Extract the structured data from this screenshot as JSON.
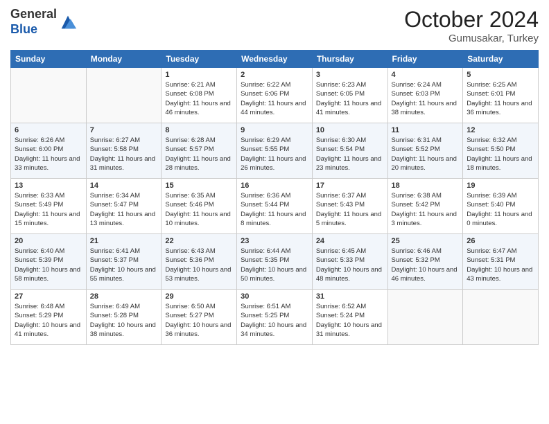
{
  "header": {
    "logo_general": "General",
    "logo_blue": "Blue",
    "month_title": "October 2024",
    "location": "Gumusakar, Turkey"
  },
  "days_of_week": [
    "Sunday",
    "Monday",
    "Tuesday",
    "Wednesday",
    "Thursday",
    "Friday",
    "Saturday"
  ],
  "weeks": [
    [
      {
        "day": "",
        "sunrise": "",
        "sunset": "",
        "daylight": ""
      },
      {
        "day": "",
        "sunrise": "",
        "sunset": "",
        "daylight": ""
      },
      {
        "day": "1",
        "sunrise": "Sunrise: 6:21 AM",
        "sunset": "Sunset: 6:08 PM",
        "daylight": "Daylight: 11 hours and 46 minutes."
      },
      {
        "day": "2",
        "sunrise": "Sunrise: 6:22 AM",
        "sunset": "Sunset: 6:06 PM",
        "daylight": "Daylight: 11 hours and 44 minutes."
      },
      {
        "day": "3",
        "sunrise": "Sunrise: 6:23 AM",
        "sunset": "Sunset: 6:05 PM",
        "daylight": "Daylight: 11 hours and 41 minutes."
      },
      {
        "day": "4",
        "sunrise": "Sunrise: 6:24 AM",
        "sunset": "Sunset: 6:03 PM",
        "daylight": "Daylight: 11 hours and 38 minutes."
      },
      {
        "day": "5",
        "sunrise": "Sunrise: 6:25 AM",
        "sunset": "Sunset: 6:01 PM",
        "daylight": "Daylight: 11 hours and 36 minutes."
      }
    ],
    [
      {
        "day": "6",
        "sunrise": "Sunrise: 6:26 AM",
        "sunset": "Sunset: 6:00 PM",
        "daylight": "Daylight: 11 hours and 33 minutes."
      },
      {
        "day": "7",
        "sunrise": "Sunrise: 6:27 AM",
        "sunset": "Sunset: 5:58 PM",
        "daylight": "Daylight: 11 hours and 31 minutes."
      },
      {
        "day": "8",
        "sunrise": "Sunrise: 6:28 AM",
        "sunset": "Sunset: 5:57 PM",
        "daylight": "Daylight: 11 hours and 28 minutes."
      },
      {
        "day": "9",
        "sunrise": "Sunrise: 6:29 AM",
        "sunset": "Sunset: 5:55 PM",
        "daylight": "Daylight: 11 hours and 26 minutes."
      },
      {
        "day": "10",
        "sunrise": "Sunrise: 6:30 AM",
        "sunset": "Sunset: 5:54 PM",
        "daylight": "Daylight: 11 hours and 23 minutes."
      },
      {
        "day": "11",
        "sunrise": "Sunrise: 6:31 AM",
        "sunset": "Sunset: 5:52 PM",
        "daylight": "Daylight: 11 hours and 20 minutes."
      },
      {
        "day": "12",
        "sunrise": "Sunrise: 6:32 AM",
        "sunset": "Sunset: 5:50 PM",
        "daylight": "Daylight: 11 hours and 18 minutes."
      }
    ],
    [
      {
        "day": "13",
        "sunrise": "Sunrise: 6:33 AM",
        "sunset": "Sunset: 5:49 PM",
        "daylight": "Daylight: 11 hours and 15 minutes."
      },
      {
        "day": "14",
        "sunrise": "Sunrise: 6:34 AM",
        "sunset": "Sunset: 5:47 PM",
        "daylight": "Daylight: 11 hours and 13 minutes."
      },
      {
        "day": "15",
        "sunrise": "Sunrise: 6:35 AM",
        "sunset": "Sunset: 5:46 PM",
        "daylight": "Daylight: 11 hours and 10 minutes."
      },
      {
        "day": "16",
        "sunrise": "Sunrise: 6:36 AM",
        "sunset": "Sunset: 5:44 PM",
        "daylight": "Daylight: 11 hours and 8 minutes."
      },
      {
        "day": "17",
        "sunrise": "Sunrise: 6:37 AM",
        "sunset": "Sunset: 5:43 PM",
        "daylight": "Daylight: 11 hours and 5 minutes."
      },
      {
        "day": "18",
        "sunrise": "Sunrise: 6:38 AM",
        "sunset": "Sunset: 5:42 PM",
        "daylight": "Daylight: 11 hours and 3 minutes."
      },
      {
        "day": "19",
        "sunrise": "Sunrise: 6:39 AM",
        "sunset": "Sunset: 5:40 PM",
        "daylight": "Daylight: 11 hours and 0 minutes."
      }
    ],
    [
      {
        "day": "20",
        "sunrise": "Sunrise: 6:40 AM",
        "sunset": "Sunset: 5:39 PM",
        "daylight": "Daylight: 10 hours and 58 minutes."
      },
      {
        "day": "21",
        "sunrise": "Sunrise: 6:41 AM",
        "sunset": "Sunset: 5:37 PM",
        "daylight": "Daylight: 10 hours and 55 minutes."
      },
      {
        "day": "22",
        "sunrise": "Sunrise: 6:43 AM",
        "sunset": "Sunset: 5:36 PM",
        "daylight": "Daylight: 10 hours and 53 minutes."
      },
      {
        "day": "23",
        "sunrise": "Sunrise: 6:44 AM",
        "sunset": "Sunset: 5:35 PM",
        "daylight": "Daylight: 10 hours and 50 minutes."
      },
      {
        "day": "24",
        "sunrise": "Sunrise: 6:45 AM",
        "sunset": "Sunset: 5:33 PM",
        "daylight": "Daylight: 10 hours and 48 minutes."
      },
      {
        "day": "25",
        "sunrise": "Sunrise: 6:46 AM",
        "sunset": "Sunset: 5:32 PM",
        "daylight": "Daylight: 10 hours and 46 minutes."
      },
      {
        "day": "26",
        "sunrise": "Sunrise: 6:47 AM",
        "sunset": "Sunset: 5:31 PM",
        "daylight": "Daylight: 10 hours and 43 minutes."
      }
    ],
    [
      {
        "day": "27",
        "sunrise": "Sunrise: 6:48 AM",
        "sunset": "Sunset: 5:29 PM",
        "daylight": "Daylight: 10 hours and 41 minutes."
      },
      {
        "day": "28",
        "sunrise": "Sunrise: 6:49 AM",
        "sunset": "Sunset: 5:28 PM",
        "daylight": "Daylight: 10 hours and 38 minutes."
      },
      {
        "day": "29",
        "sunrise": "Sunrise: 6:50 AM",
        "sunset": "Sunset: 5:27 PM",
        "daylight": "Daylight: 10 hours and 36 minutes."
      },
      {
        "day": "30",
        "sunrise": "Sunrise: 6:51 AM",
        "sunset": "Sunset: 5:25 PM",
        "daylight": "Daylight: 10 hours and 34 minutes."
      },
      {
        "day": "31",
        "sunrise": "Sunrise: 6:52 AM",
        "sunset": "Sunset: 5:24 PM",
        "daylight": "Daylight: 10 hours and 31 minutes."
      },
      {
        "day": "",
        "sunrise": "",
        "sunset": "",
        "daylight": ""
      },
      {
        "day": "",
        "sunrise": "",
        "sunset": "",
        "daylight": ""
      }
    ]
  ]
}
